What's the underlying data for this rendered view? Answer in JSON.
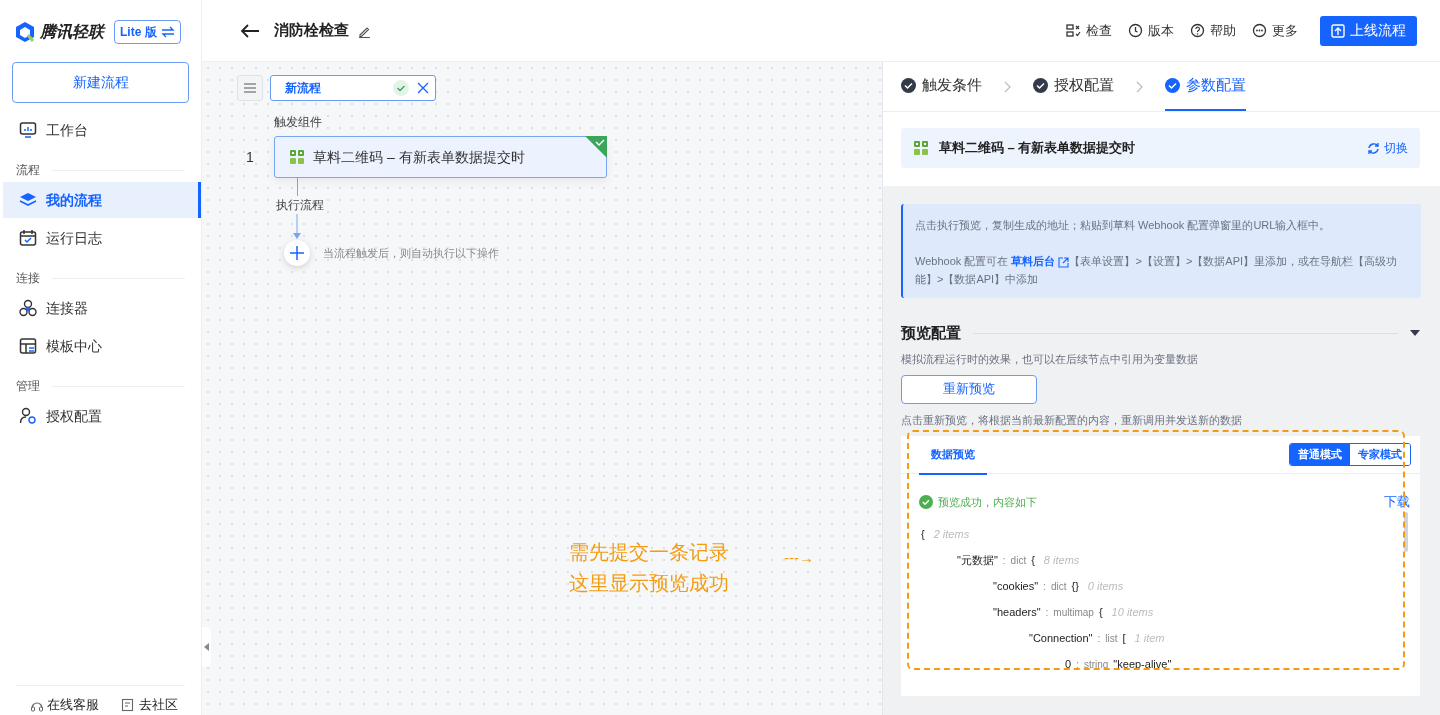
{
  "sidebar": {
    "brand": "腾讯轻联",
    "edition": "Lite 版",
    "new_button": "新建流程",
    "items": [
      {
        "kind": "item",
        "label": "工作台",
        "selected": false
      },
      {
        "kind": "section",
        "label": "流程"
      },
      {
        "kind": "item",
        "label": "我的流程",
        "selected": true
      },
      {
        "kind": "item",
        "label": "运行日志",
        "selected": false
      },
      {
        "kind": "section",
        "label": "连接"
      },
      {
        "kind": "item",
        "label": "连接器",
        "selected": false
      },
      {
        "kind": "item",
        "label": "模板中心",
        "selected": false
      },
      {
        "kind": "section",
        "label": "管理"
      },
      {
        "kind": "item",
        "label": "授权配置",
        "selected": false
      }
    ],
    "footer": [
      {
        "label": "在线客服"
      },
      {
        "label": "去社区"
      }
    ]
  },
  "header": {
    "title": "消防栓检查",
    "actions": [
      {
        "label": "检查"
      },
      {
        "label": "版本"
      },
      {
        "label": "帮助"
      },
      {
        "label": "更多"
      }
    ],
    "publish_button": "上线流程"
  },
  "canvas": {
    "flow_name": "新流程",
    "trigger_label": "触发组件",
    "trigger": {
      "index": "1",
      "text": "草料二维码 – 有新表单数据提交时",
      "done": true
    },
    "flow_label": "执行流程",
    "add_hint": "当流程触发后，则自动执行以下操作"
  },
  "annotation": {
    "lines": [
      "需先提交一条记录",
      "这里显示预览成功"
    ],
    "arrow": "---→"
  },
  "panel": {
    "steps": [
      {
        "label": "触发条件",
        "selected": false
      },
      {
        "label": "授权配置",
        "selected": false
      },
      {
        "label": "参数配置",
        "selected": true
      }
    ],
    "summary": {
      "text": "草料二维码 – 有新表单数据提交时",
      "action": "切换"
    },
    "info": {
      "line1": "点击执行预览，复制生成的地址；粘贴到草料 Webhook 配置弹窗里的URL输入框中。",
      "line2_before": "Webhook 配置可在 ",
      "link": "草料后台",
      "line2_after": "【表单设置】>【设置】>【数据API】里添加，或在导航栏【高级功能】>【数据API】中添加"
    },
    "preview": {
      "title": "预览配置",
      "description": "模拟流程运行时的效果，也可以在后续节点中引用为变量数据",
      "button": "重新预览",
      "hint": "点击重新预览，将根据当前最新配置的内容，重新调用并发送新的数据",
      "tab": "数据预览",
      "modes": [
        {
          "label": "普通模式",
          "selected": true
        },
        {
          "label": "专家模式",
          "selected": false
        }
      ],
      "status": "预览成功，内容如下",
      "download": "下载",
      "tree": {
        "brace": "{",
        "count": "2 items",
        "children": [
          {
            "key": "\"元数据\"",
            "sep": ":",
            "type": "dict",
            "brace": "{",
            "count": "8 items",
            "children": [
              {
                "key": "\"cookies\"",
                "sep": ":",
                "type": "dict",
                "brace": "{}",
                "count": "0 items"
              },
              {
                "key": "\"headers\"",
                "sep": ":",
                "type": "multimap",
                "brace": "{",
                "count": "10 items",
                "children": [
                  {
                    "key": "\"Connection\"",
                    "sep": ":",
                    "type": "list",
                    "brace": "[",
                    "count": "1 item",
                    "children": [
                      {
                        "key": "0",
                        "sep": ":",
                        "type": "string",
                        "value": "\"keep-alive\""
                      }
                    ]
                  }
                ]
              }
            ]
          }
        ]
      }
    }
  }
}
